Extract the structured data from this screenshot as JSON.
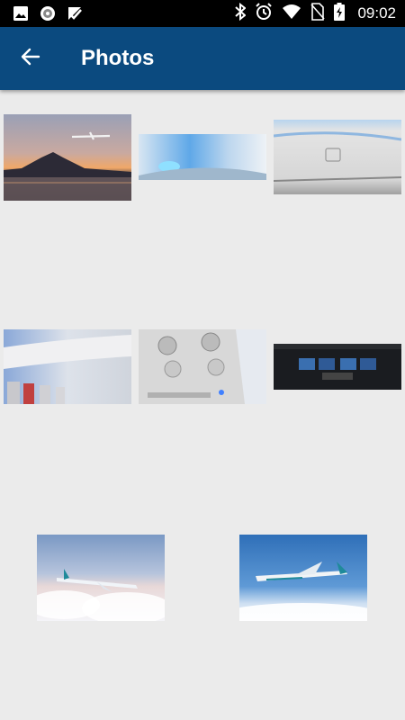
{
  "status_bar": {
    "time": "09:02",
    "left_icons": [
      "image-notification-icon",
      "circle-notification-icon",
      "check-notification-icon"
    ],
    "right_icons": [
      "bluetooth-icon",
      "alarm-icon",
      "wifi-icon",
      "no-sim-icon",
      "battery-charging-icon"
    ]
  },
  "app_bar": {
    "title": "Photos",
    "back_icon": "arrow-back-icon",
    "color": "#0b4a7f"
  },
  "photos": [
    {
      "name": "photo-airplane-mount-fuji-sunset"
    },
    {
      "name": "photo-cabin-window-blue-light"
    },
    {
      "name": "photo-overhead-bin"
    },
    {
      "name": "photo-cabin-interior-seats"
    },
    {
      "name": "photo-overhead-panel-vents"
    },
    {
      "name": "photo-cockpit-instruments"
    },
    {
      "name": "photo-airplane-above-clouds"
    },
    {
      "name": "photo-airplane-blue-sky"
    }
  ]
}
